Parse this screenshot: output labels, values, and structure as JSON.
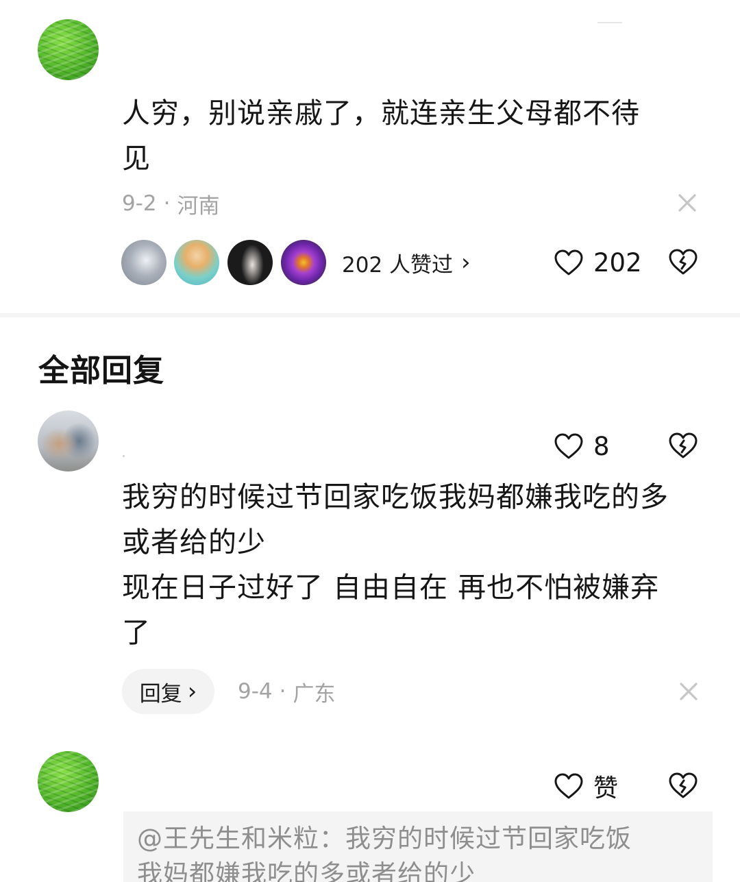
{
  "comment": {
    "text": "人穷，别说亲戚了，就连亲生父母都不待见",
    "line1": "人穷，别说亲戚了，就连亲生父母都不待",
    "line2": "见",
    "date": "9-2",
    "sep": "·",
    "location": "河南",
    "close_icon": "close-icon",
    "likers_text": "202 人赞过",
    "likers_chevron": "›",
    "like_count": "202"
  },
  "replies_header": "全部回复",
  "reply1": {
    "like_count": "8",
    "line1": "我穷的时候过节回家吃饭我妈都嫌我吃的多",
    "line2": "或者给的少",
    "line3": "现在日子过好了 自由自在 再也不怕被嫌弃",
    "line4": "了",
    "reply_button": "回复",
    "reply_chevron": "›",
    "date": "9-4",
    "sep": "·",
    "location": "广东"
  },
  "reply2": {
    "like_label": "赞",
    "quote_line1": "@王先生和米粒：我穷的时候过节回家吃饭",
    "quote_line2": "我妈都嫌我吃的多或者给的少"
  },
  "colors": {
    "text": "#161616",
    "meta": "#a3a3a3",
    "divider": "#f5f5f5",
    "pill_bg": "#f3f3f3",
    "quote_bg": "#f4f4f4"
  },
  "icons": {
    "like": "heart-outline-icon",
    "dislike": "broken-heart-icon",
    "close": "close-icon"
  }
}
